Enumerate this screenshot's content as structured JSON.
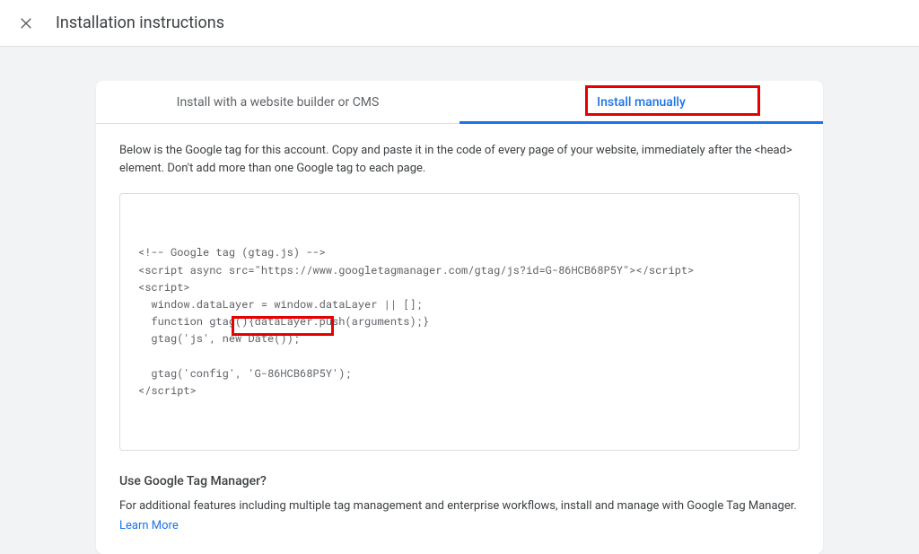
{
  "header": {
    "title": "Installation instructions"
  },
  "tabs": {
    "cms": "Install with a website builder or CMS",
    "manual": "Install manually"
  },
  "instructions": {
    "intro": "Below is the Google tag for this account. Copy and paste it in the code of every page of your website, immediately after the <head> element. Don't add more than one Google tag to each page."
  },
  "code": {
    "line1": "<!-- Google tag (gtag.js) -->",
    "line2": "<script async src=\"https://www.googletagmanager.com/gtag/js?id=G-86HCB68P5Y\"></script>",
    "line3": "<script>",
    "line4": "  window.dataLayer = window.dataLayer || [];",
    "line5": "  function gtag(){dataLayer.push(arguments);}",
    "line6": "  gtag('js', new Date());",
    "line7": "",
    "line8_a": "  gtag('config', ",
    "line8_b": "'G-86HCB68P5Y');",
    "line9": "</script>"
  },
  "gtm": {
    "heading": "Use Google Tag Manager?",
    "text": "For additional features including multiple tag management and enterprise workflows, install and manage with Google Tag Manager.",
    "learn_more": "Learn More"
  }
}
